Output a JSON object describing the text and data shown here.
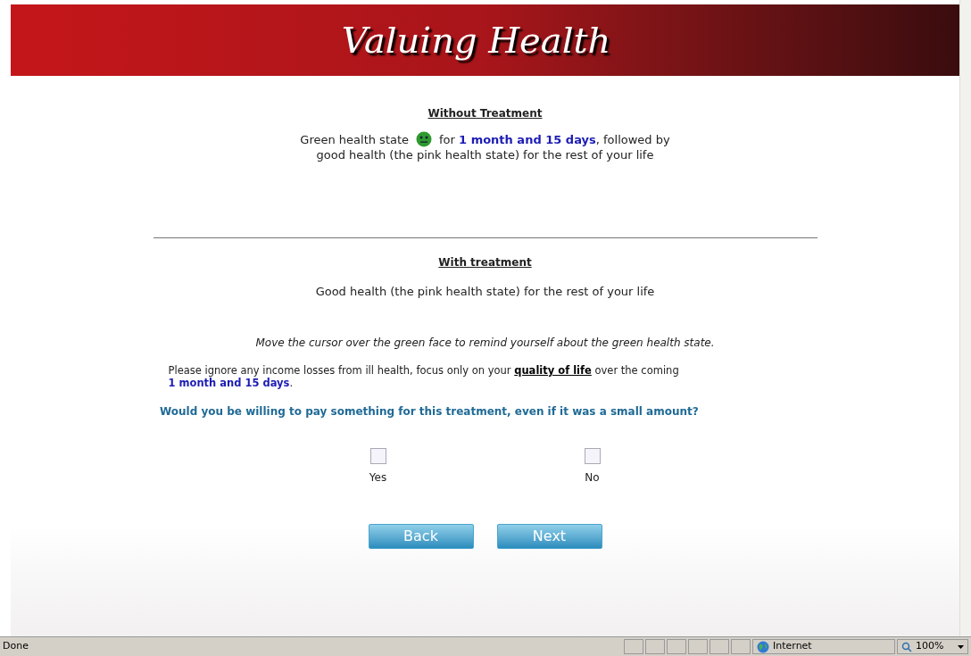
{
  "banner": {
    "title": "Valuing Health"
  },
  "without_treatment": {
    "heading": "Without Treatment",
    "lines": [
      [
        {
          "kind": "plain",
          "text": "Green health state"
        },
        {
          "kind": "face"
        },
        {
          "kind": "plain",
          "text": "for **1 month and 15 days**, followed by"
        }
      ],
      [
        {
          "kind": "plain",
          "text": "good health (the pink health state) for the rest of your life"
        }
      ]
    ]
  },
  "with_treatment": {
    "heading": "With treatment",
    "text": "Good health (the pink health state) for the rest of your life"
  },
  "hint": "Move the cursor over the green face to remind yourself about the green health state.",
  "instruction": [
    {
      "kind": "underlined",
      "text": "Please ignore any income losses from ill health, focus only on your **quality of life** over the coming"
    },
    {
      "kind": "duration",
      "text": "**1 month and 15 days**."
    }
  ],
  "question": "Would you be willing to pay something for this treatment, even if it was a small amount?",
  "options": [
    {
      "label": "Yes",
      "checked": false
    },
    {
      "label": "No",
      "checked": false
    }
  ],
  "buttons": [
    "Back",
    "Next"
  ],
  "status_bar": {
    "status": "Done",
    "zone": "Internet",
    "zoom": "100%"
  }
}
